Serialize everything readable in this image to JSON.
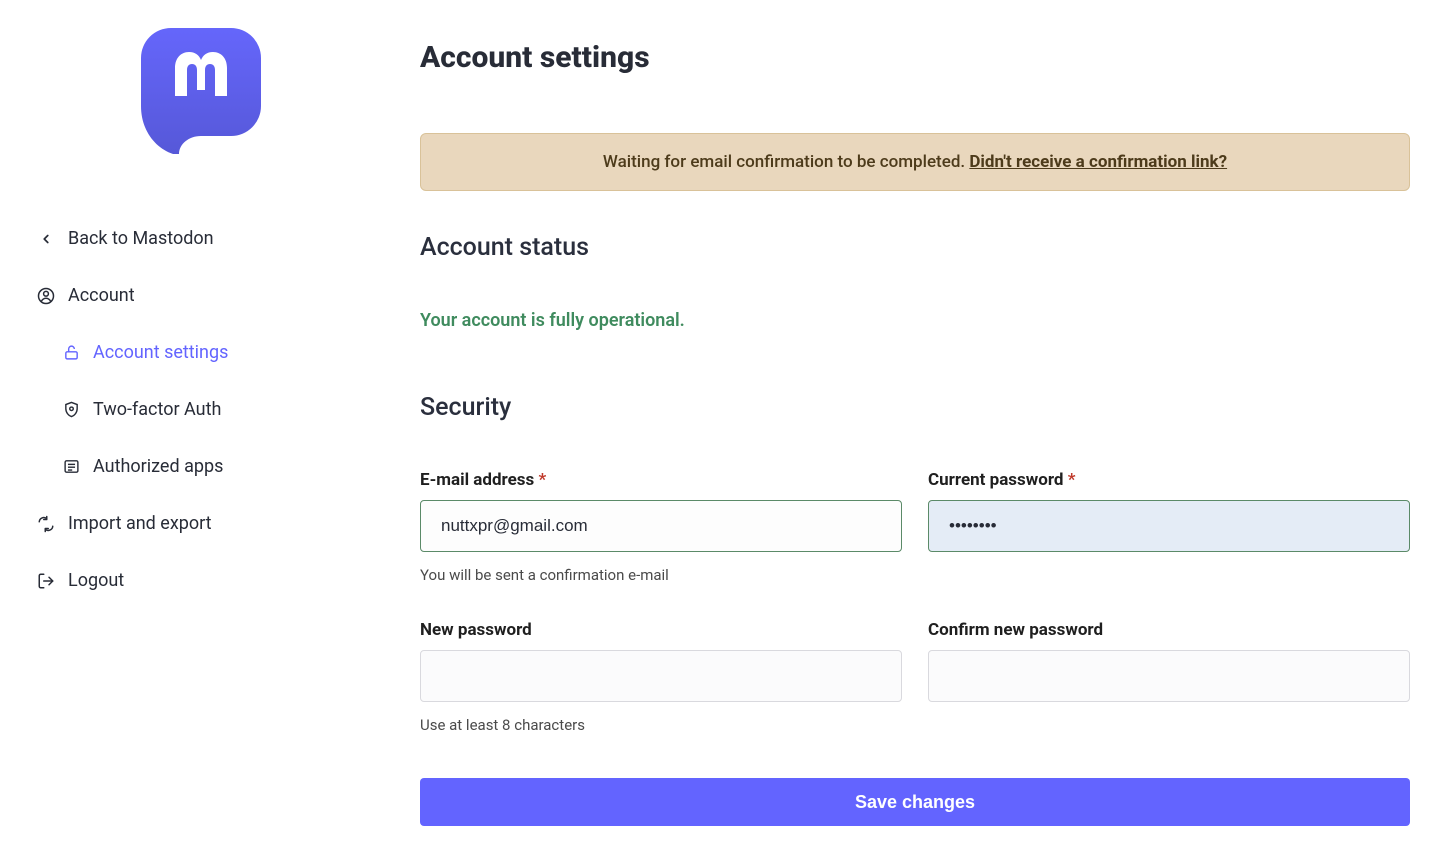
{
  "sidebar": {
    "back_label": "Back to Mastodon",
    "items": {
      "account": "Account",
      "account_settings": "Account settings",
      "two_factor": "Two-factor Auth",
      "authorized_apps": "Authorized apps",
      "import_export": "Import and export",
      "logout": "Logout"
    }
  },
  "page": {
    "title": "Account settings"
  },
  "flash": {
    "waiting_text": "Waiting for email confirmation to be completed. ",
    "link_text": "Didn't receive a confirmation link?"
  },
  "sections": {
    "account_status_title": "Account status",
    "account_status_text": "Your account is fully operational.",
    "security_title": "Security"
  },
  "form": {
    "email": {
      "label": "E-mail address",
      "value": "nuttxpr@gmail.com",
      "hint": "You will be sent a confirmation e-mail"
    },
    "current_password": {
      "label": "Current password",
      "value": "••••••••"
    },
    "new_password": {
      "label": "New password",
      "hint": "Use at least 8 characters"
    },
    "confirm_password": {
      "label": "Confirm new password"
    },
    "save_button": "Save changes",
    "required_mark": "*"
  }
}
